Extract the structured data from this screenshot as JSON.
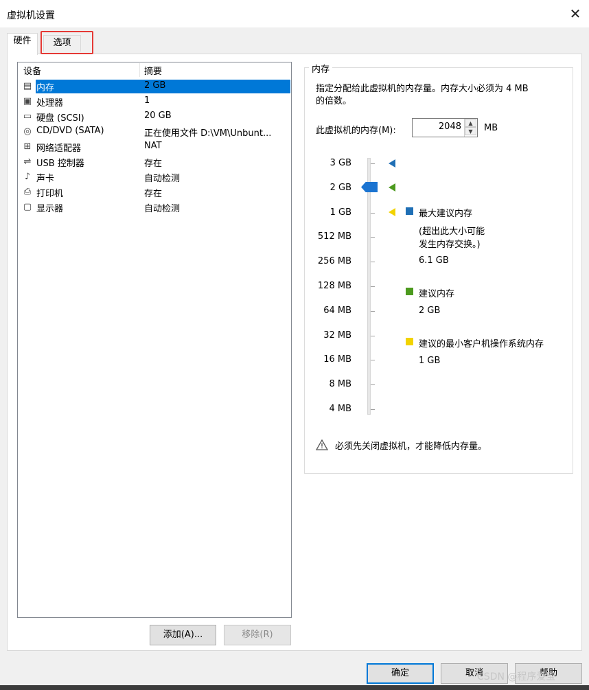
{
  "window": {
    "title": "虚拟机设置"
  },
  "tabs": [
    {
      "label": "硬件"
    },
    {
      "label": "选项"
    }
  ],
  "device_table": {
    "headers": {
      "device": "设备",
      "summary": "摘要"
    },
    "rows": [
      {
        "name": "内存",
        "summary": "2 GB",
        "icon": "memory-icon",
        "selected": true
      },
      {
        "name": "处理器",
        "summary": "1",
        "icon": "processor-icon"
      },
      {
        "name": "硬盘 (SCSI)",
        "summary": "20 GB",
        "icon": "hard-disk-icon"
      },
      {
        "name": "CD/DVD (SATA)",
        "summary": "正在使用文件 D:\\VM\\Unbunt...",
        "icon": "cd-dvd-icon"
      },
      {
        "name": "网络适配器",
        "summary": "NAT",
        "icon": "network-adapter-icon"
      },
      {
        "name": "USB 控制器",
        "summary": "存在",
        "icon": "usb-controller-icon"
      },
      {
        "name": "声卡",
        "summary": "自动检测",
        "icon": "sound-card-icon"
      },
      {
        "name": "打印机",
        "summary": "存在",
        "icon": "printer-icon"
      },
      {
        "name": "显示器",
        "summary": "自动检测",
        "icon": "display-icon"
      }
    ]
  },
  "buttons": {
    "add": "添加(A)...",
    "remove": "移除(R)",
    "ok": "确定",
    "cancel": "取消",
    "help": "帮助"
  },
  "memory": {
    "group_title": "内存",
    "description_line1": "指定分配给此虚拟机的内存量。内存大小必须为 4 MB",
    "description_line2": "的倍数。",
    "input_label": "此虚拟机的内存(M):",
    "value": "2048",
    "unit": "MB",
    "scale_labels": [
      "3 GB",
      "2 GB",
      "1 GB",
      "512 MB",
      "256 MB",
      "128 MB",
      "64 MB",
      "32 MB",
      "16 MB",
      "8 MB",
      "4 MB"
    ],
    "slider_value": "2 GB",
    "legend": {
      "max_recommended": {
        "title": "最大建议内存",
        "note_line1": "(超出此大小可能",
        "note_line2": "发生内存交换。)",
        "value": "6.1 GB",
        "color": "#1f6fb5"
      },
      "recommended": {
        "title": "建议内存",
        "value": "2 GB",
        "color": "#4c9a1e"
      },
      "guest_min": {
        "title": "建议的最小客户机操作系统内存",
        "value": "1 GB",
        "color": "#f2d300"
      }
    },
    "warning": "必须先关闭虚拟机，才能降低内存量。"
  },
  "watermark": "CSDN @程序爱宝"
}
